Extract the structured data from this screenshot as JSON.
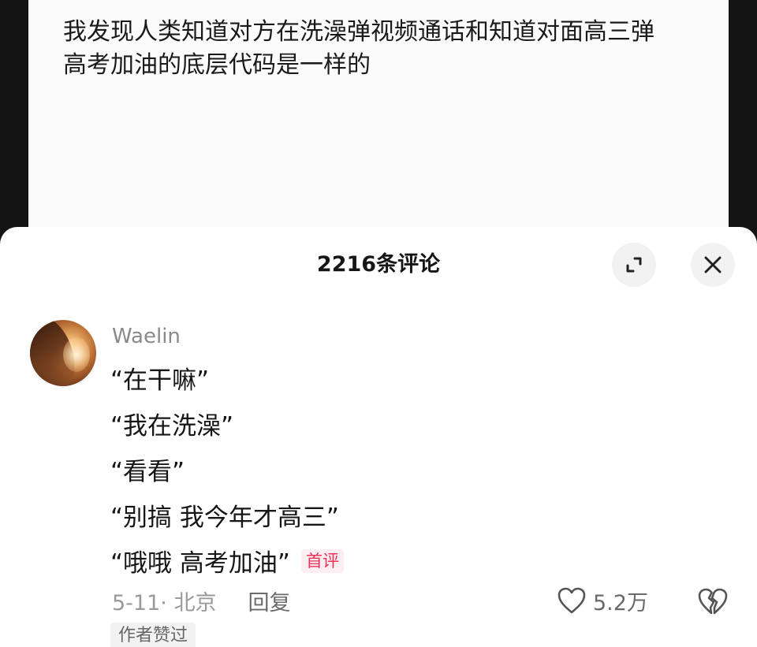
{
  "video": {
    "caption_line_1": "我发现人类知道对方在洗澡弹视频通话和知道对面高三弹",
    "caption_line_2": "高考加油的底层代码是一样的"
  },
  "comments_panel": {
    "title": "2216条评论",
    "expand_icon": "expand-icon",
    "close_icon": "close-icon"
  },
  "comment": {
    "username": "Waelin",
    "lines": [
      "“在干嘛”",
      "“我在洗澡”",
      "“看看”",
      "“别搞 我今年才高三”",
      "“哦哦 高考加油”"
    ],
    "badge": "首评",
    "date_location": "5-11· 北京",
    "reply_label": "回复",
    "like_icon": "heart-icon",
    "like_count": "5.2万",
    "dislike_icon": "broken-heart-icon",
    "author_liked": "作者赞过",
    "badge_color": "#ee3158"
  }
}
